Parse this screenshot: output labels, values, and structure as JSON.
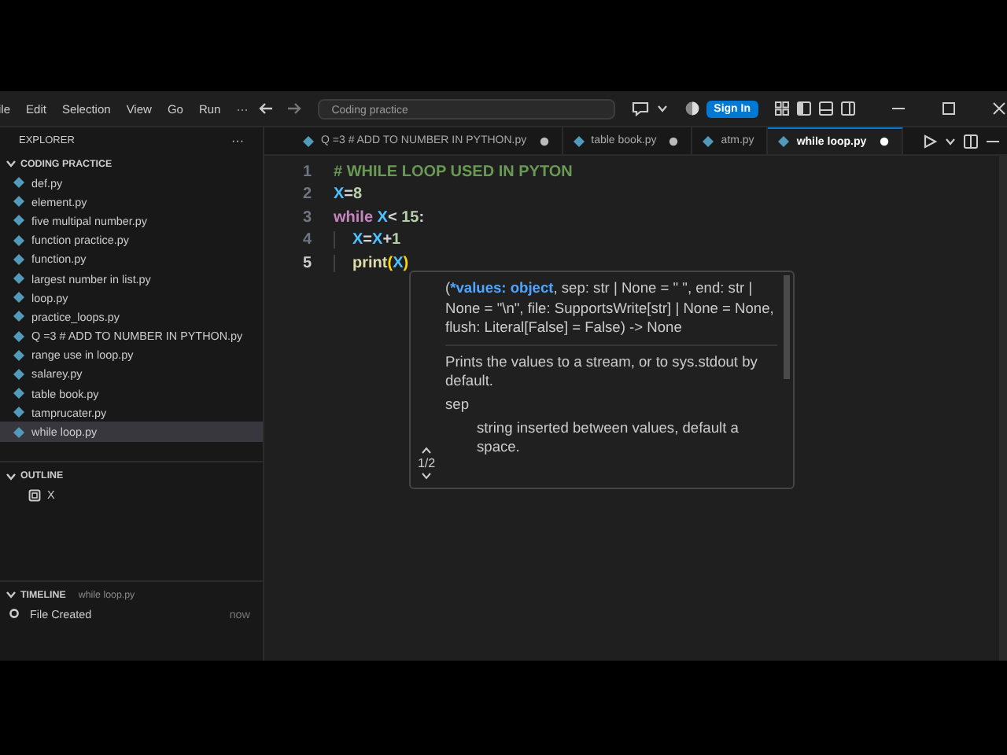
{
  "menu": [
    "ile",
    "Edit",
    "Selection",
    "View",
    "Go",
    "Run",
    "···"
  ],
  "command_center": {
    "text": "Coding practice"
  },
  "sign_in": "Sign In",
  "sidebar": {
    "title": "EXPLORER",
    "more": "···",
    "folder": {
      "name": "CODING PRACTICE",
      "expanded": true,
      "files": [
        {
          "name": "def.py",
          "selected": false
        },
        {
          "name": "element.py",
          "selected": false
        },
        {
          "name": "five multipal number.py",
          "selected": false
        },
        {
          "name": "function practice.py",
          "selected": false
        },
        {
          "name": "function.py",
          "selected": false
        },
        {
          "name": "largest number in list.py",
          "selected": false
        },
        {
          "name": "loop.py",
          "selected": false
        },
        {
          "name": "practice_loops.py",
          "selected": false
        },
        {
          "name": "Q =3 # ADD TO NUMBER IN PYTHON.py",
          "selected": false
        },
        {
          "name": "range use in loop.py",
          "selected": false
        },
        {
          "name": "salarey.py",
          "selected": false
        },
        {
          "name": "table book.py",
          "selected": false
        },
        {
          "name": "tamprucater.py",
          "selected": false
        },
        {
          "name": "while loop.py",
          "selected": true
        }
      ]
    },
    "outline": {
      "title": "OUTLINE",
      "expanded": true,
      "items": [
        "X"
      ]
    },
    "timeline": {
      "title": "TIMELINE",
      "file": "while loop.py",
      "expanded": true,
      "entries": [
        {
          "label": "File Created",
          "time": "now"
        }
      ]
    }
  },
  "tabs": [
    {
      "label": "Q =3 # ADD TO NUMBER IN PYTHON.py",
      "selected": false,
      "modified": true
    },
    {
      "label": "table book.py",
      "selected": false,
      "modified": true
    },
    {
      "label": "atm.py",
      "selected": false,
      "modified": false
    },
    {
      "label": "while loop.py",
      "selected": true,
      "modified": true
    }
  ],
  "editor": {
    "lines": [
      {
        "number": "1",
        "active": false,
        "tokens": [
          {
            "text": "# WHILE LOOP USED IN PYTON",
            "kind": "comment"
          }
        ]
      },
      {
        "number": "2",
        "active": false,
        "tokens": [
          {
            "text": "X",
            "kind": "var"
          },
          {
            "text": "=",
            "kind": "op"
          },
          {
            "text": "8",
            "kind": "number"
          }
        ]
      },
      {
        "number": "3",
        "active": false,
        "tokens": [
          {
            "text": "while",
            "kind": "keyword"
          },
          {
            "text": " X",
            "kind": "var"
          },
          {
            "text": "< ",
            "kind": "op"
          },
          {
            "text": "15",
            "kind": "number"
          },
          {
            "text": ":",
            "kind": "op"
          }
        ],
        "children": [
          {
            "number": "4",
            "active": false,
            "tokens": [
              {
                "text": "X",
                "kind": "var"
              },
              {
                "text": "=",
                "kind": "op"
              },
              {
                "text": "X",
                "kind": "var"
              },
              {
                "text": "+",
                "kind": "op"
              },
              {
                "text": "1",
                "kind": "number"
              }
            ]
          },
          {
            "number": "5",
            "active": true,
            "tokens": [
              {
                "text": "print",
                "kind": "func"
              },
              {
                "text": "(",
                "kind": "paren"
              },
              {
                "text": "X",
                "kind": "var"
              },
              {
                "text": ")",
                "kind": "paren"
              }
            ]
          }
        ]
      }
    ]
  },
  "hover": {
    "signature": [
      {
        "text": "(",
        "kind": "plain"
      },
      {
        "text": "*values: object",
        "kind": "param"
      },
      {
        "text": ", sep: str | None = \" \", end: str | None = \"\\n\", file: SupportsWrite[str] | None = None, flush: Literal[False] = False) -> None",
        "kind": "plain"
      }
    ],
    "description": "Prints the values to a stream, or to sys.stdout by default.",
    "param": "sep",
    "param_doc": "string inserted between values, default a space.",
    "page": "1/2"
  }
}
